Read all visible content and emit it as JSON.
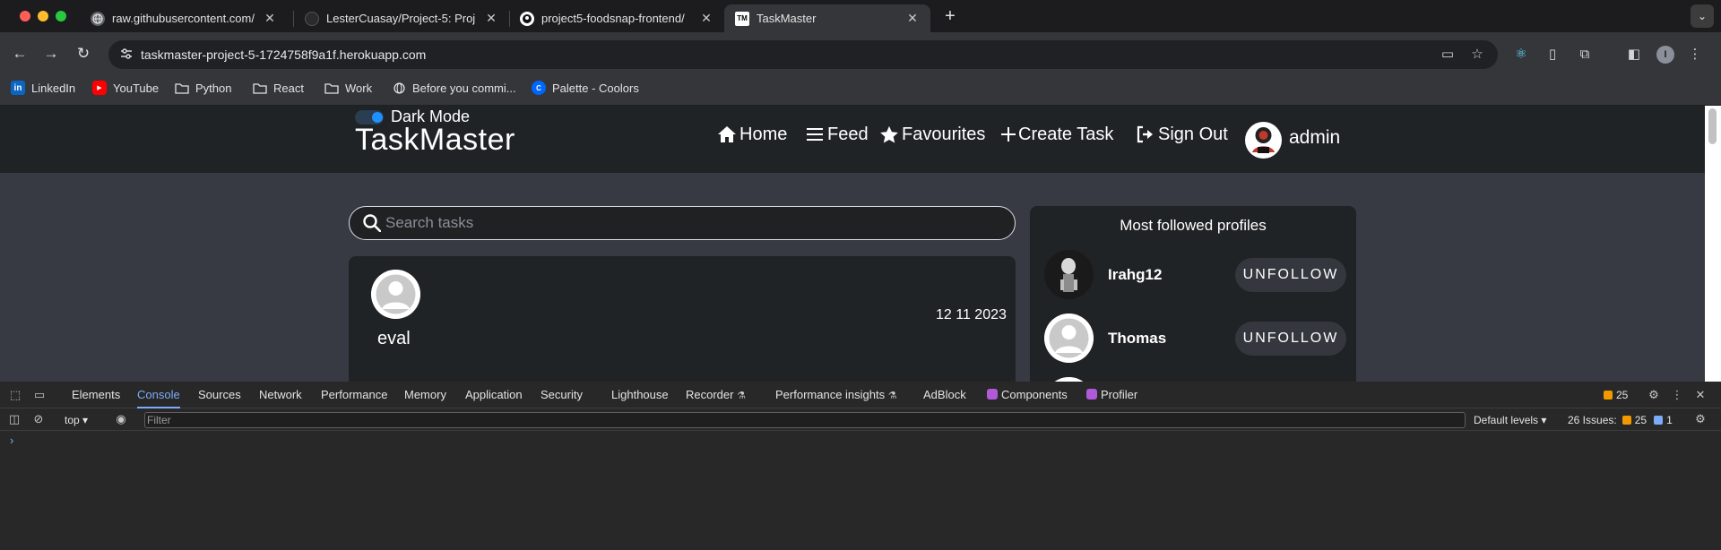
{
  "tabs": [
    {
      "title": "raw.githubusercontent.com/",
      "favicon": "globe-icon",
      "active": false
    },
    {
      "title": "LesterCuasay/Project-5: Proj",
      "favicon": "github-icon",
      "active": false
    },
    {
      "title": "project5-foodsnap-frontend/",
      "favicon": "github-icon",
      "active": false
    },
    {
      "title": "TaskMaster",
      "favicon": "TM",
      "active": true
    }
  ],
  "address_bar": {
    "url": "taskmaster-project-5-1724758f9a1f.herokuapp.com"
  },
  "bookmarks": [
    {
      "label": "LinkedIn",
      "icon": "in"
    },
    {
      "label": "YouTube",
      "icon": "youtube-icon"
    },
    {
      "label": "Python",
      "icon": "folder-icon"
    },
    {
      "label": "React",
      "icon": "folder-icon"
    },
    {
      "label": "Work",
      "icon": "folder-icon"
    },
    {
      "label": "Before you commi...",
      "icon": "globe-icon"
    },
    {
      "label": "Palette - Coolors",
      "icon": "coolors-icon"
    }
  ],
  "profile_initial": "I",
  "site": {
    "dark_mode_label": "Dark Mode",
    "dark_mode_on": true,
    "brand": "TaskMaster",
    "nav": [
      {
        "label": "Home",
        "icon": "home-icon"
      },
      {
        "label": "Feed",
        "icon": "bars-icon"
      },
      {
        "label": "Favourites",
        "icon": "star-icon"
      },
      {
        "label": "Create Task",
        "icon": "plus-icon"
      },
      {
        "label": "Sign Out",
        "icon": "sign-out-icon"
      }
    ],
    "user": "admin",
    "search_placeholder": "Search tasks",
    "task": {
      "author": "eval",
      "date": "12 11 2023"
    },
    "profiles_title": "Most followed profiles",
    "profiles": [
      {
        "name": "Irahg12",
        "button": "UNFOLLOW"
      },
      {
        "name": "Thomas",
        "button": "UNFOLLOW"
      }
    ]
  },
  "devtools": {
    "tabs": [
      "Elements",
      "Console",
      "Sources",
      "Network",
      "Performance",
      "Memory",
      "Application",
      "Security",
      "Lighthouse",
      "Recorder",
      "Performance insights",
      "AdBlock",
      "Components",
      "Profiler"
    ],
    "active_tab": "Console",
    "issues_badge": "25",
    "context": "top",
    "filter_placeholder": "Filter",
    "levels": "Default levels",
    "issues_label": "26 Issues:",
    "issues_warn": "25",
    "issues_info": "1",
    "prompt": "›"
  },
  "colors": {
    "accent": "#1e90ff",
    "console_tab": "#7cacf8",
    "page_bg": "#373a43",
    "nav_bg": "#202326"
  }
}
